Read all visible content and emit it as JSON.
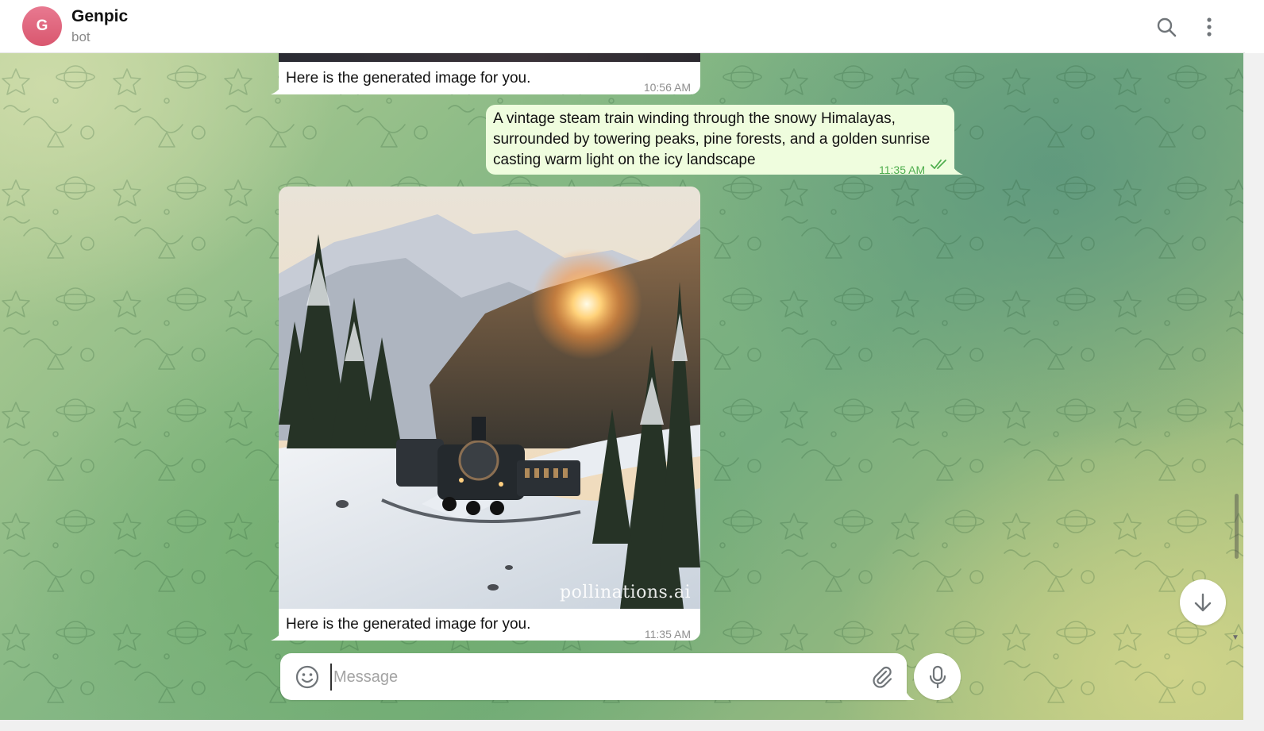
{
  "header": {
    "avatar_letter": "G",
    "title": "Genpic",
    "subtitle": "bot",
    "search_icon": "search-icon",
    "menu_icon": "more-vertical-icon"
  },
  "messages": [
    {
      "direction": "incoming",
      "text": "Here is the generated image for you.",
      "time": "10:56 AM"
    },
    {
      "direction": "outgoing",
      "lines": [
        "A vintage steam train winding through the snowy Himalayas,",
        "surrounded by towering peaks, pine forests, and a golden sunrise",
        "casting warm light on the icy landscape"
      ],
      "time": "11:35 AM",
      "status_icon": "double-check-icon"
    },
    {
      "direction": "incoming",
      "has_image": true,
      "watermark": "pollinations.ai",
      "text": "Here is the generated image for you.",
      "time": "11:35 AM"
    }
  ],
  "composer": {
    "placeholder": "Message",
    "value": "",
    "emoji_icon": "smile-icon",
    "attach_icon": "paperclip-icon",
    "mic_icon": "microphone-icon"
  },
  "scroll_down_icon": "arrow-down-icon",
  "colors": {
    "incoming_bubble": "#ffffff",
    "outgoing_bubble": "#effdde",
    "outgoing_time": "#4fae4e",
    "avatar": "#e06a80"
  }
}
